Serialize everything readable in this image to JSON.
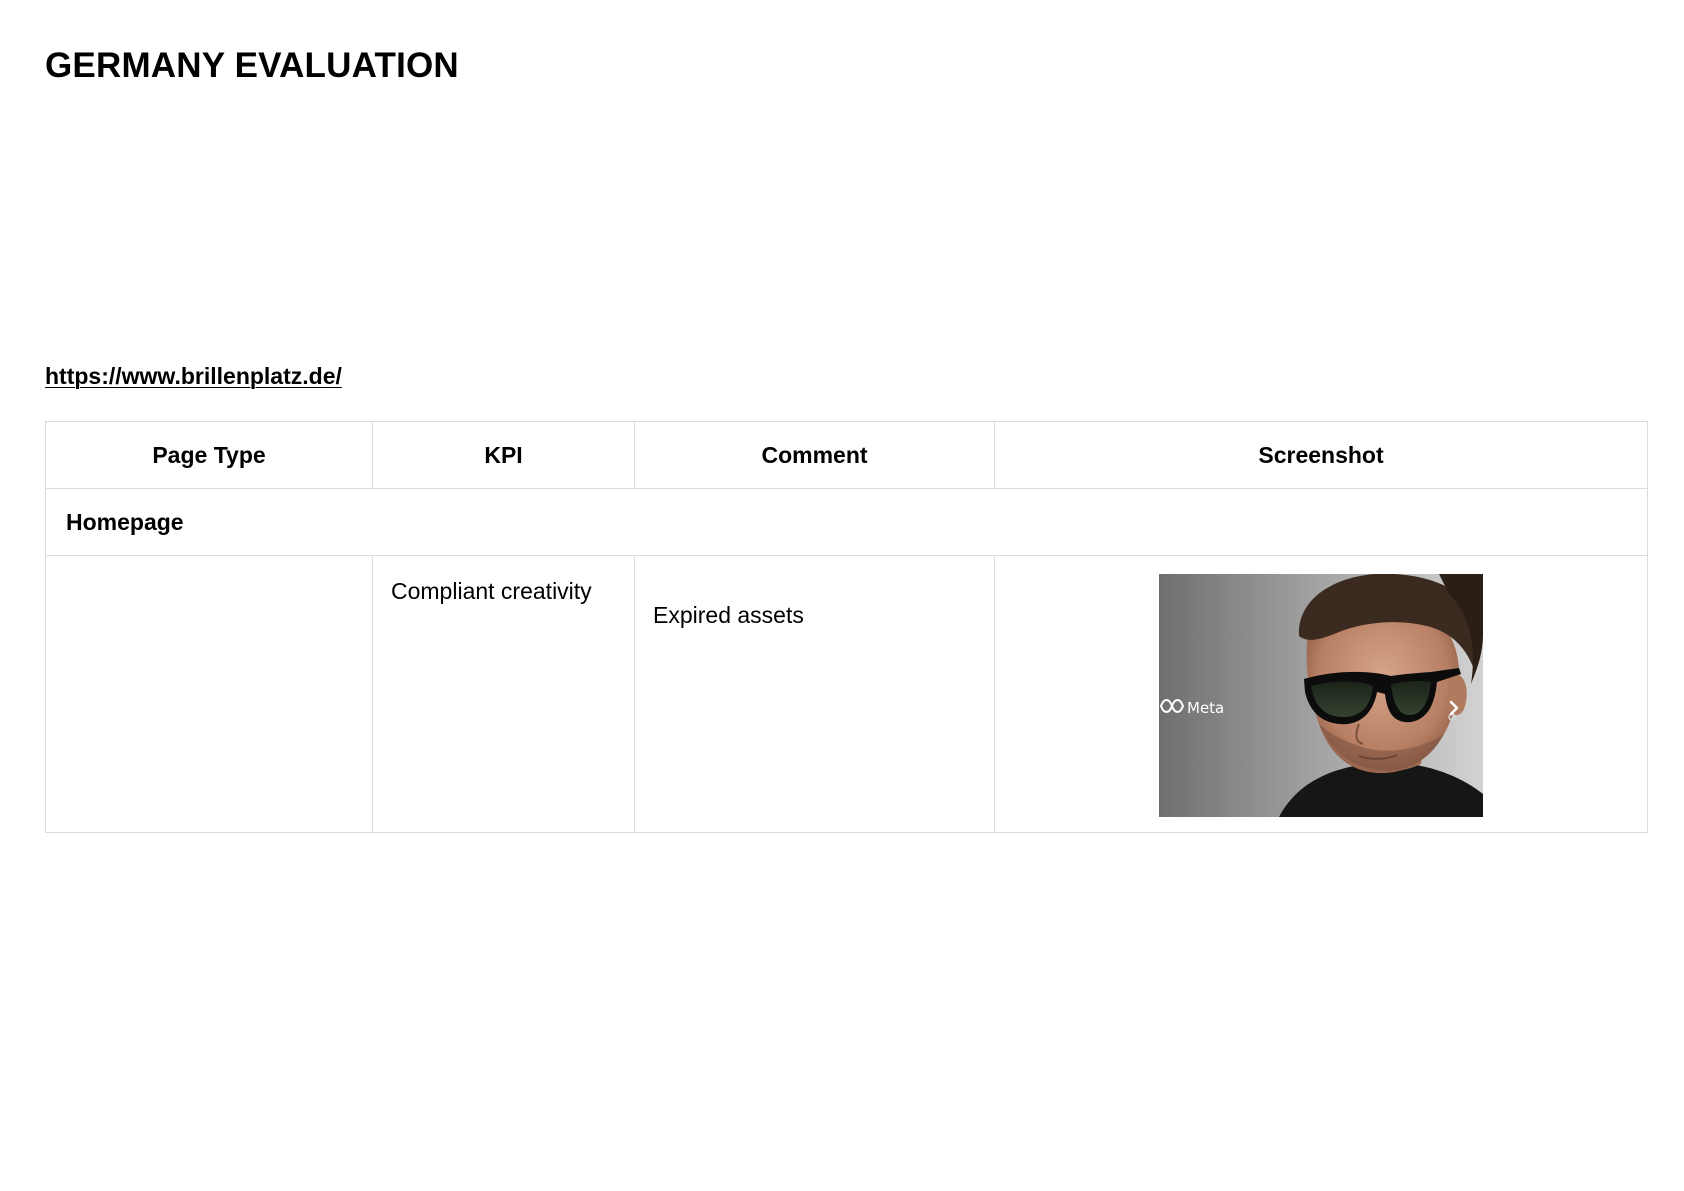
{
  "document": {
    "title": "GERMANY EVALUATION",
    "url_link": "https://www.brillenplatz.de/"
  },
  "table": {
    "headers": {
      "page_type": "Page Type",
      "kpi": "KPI",
      "comment": "Comment",
      "screenshot": "Screenshot"
    },
    "sections": [
      {
        "name": "Homepage",
        "rows": [
          {
            "page_type": "",
            "kpi": "Compliant creativity",
            "comment": "Expired assets",
            "screenshot": {
              "logo_text": "Meta",
              "description_icon": "sunglasses-model-photo"
            }
          }
        ]
      }
    ]
  },
  "colors": {
    "table_border": "#dcdcdc",
    "text": "#000000"
  }
}
